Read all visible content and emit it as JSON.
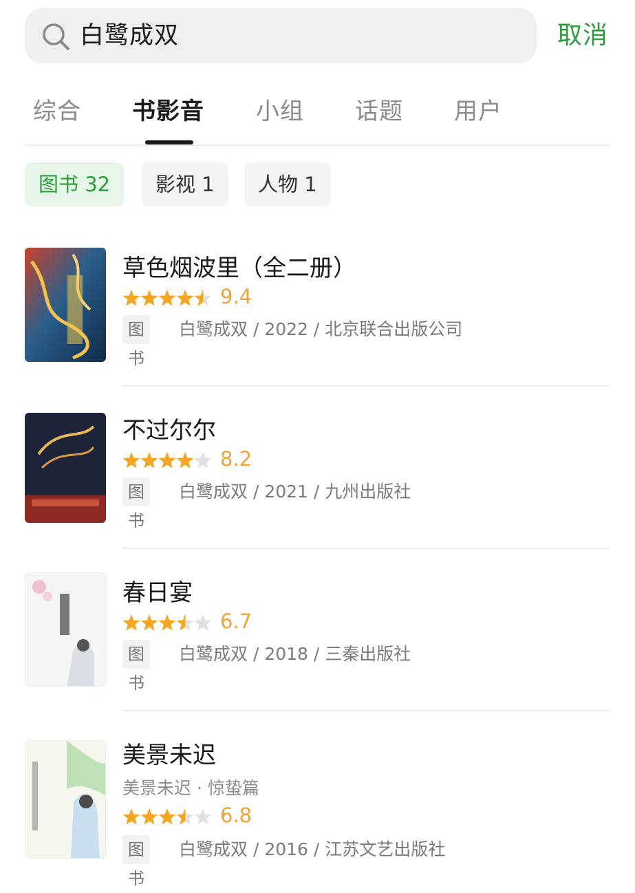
{
  "search": {
    "query": "白鹭成双",
    "cancel_label": "取消"
  },
  "tabs": [
    {
      "label": "综合",
      "active": false
    },
    {
      "label": "书影音",
      "active": true
    },
    {
      "label": "小组",
      "active": false
    },
    {
      "label": "话题",
      "active": false
    },
    {
      "label": "用户",
      "active": false
    }
  ],
  "filters": [
    {
      "label": "图书 32",
      "active": true
    },
    {
      "label": "影视 1",
      "active": false
    },
    {
      "label": "人物 1",
      "active": false
    }
  ],
  "colors": {
    "accent": "#2c9b3b",
    "star": "#f5a623",
    "star_empty": "#e0e0e0"
  },
  "results": [
    {
      "title": "草色烟波里（全二册）",
      "rating_stars": 4.5,
      "score": "9.4",
      "type": "图书",
      "meta": "白鹭成双 / 2022 / 北京联合出版公司"
    },
    {
      "title": "不过尔尔",
      "rating_stars": 4,
      "score": "8.2",
      "type": "图书",
      "meta": "白鹭成双 / 2021 / 九州出版社"
    },
    {
      "title": "春日宴",
      "rating_stars": 3.5,
      "score": "6.7",
      "type": "图书",
      "meta": "白鹭成双 / 2018 / 三秦出版社"
    },
    {
      "title": "美景未迟",
      "subtitle": "美景未迟 · 惊蛰篇",
      "rating_stars": 3.5,
      "score": "6.8",
      "type": "图书",
      "meta": "白鹭成双 / 2016 / 江苏文艺出版社"
    }
  ]
}
